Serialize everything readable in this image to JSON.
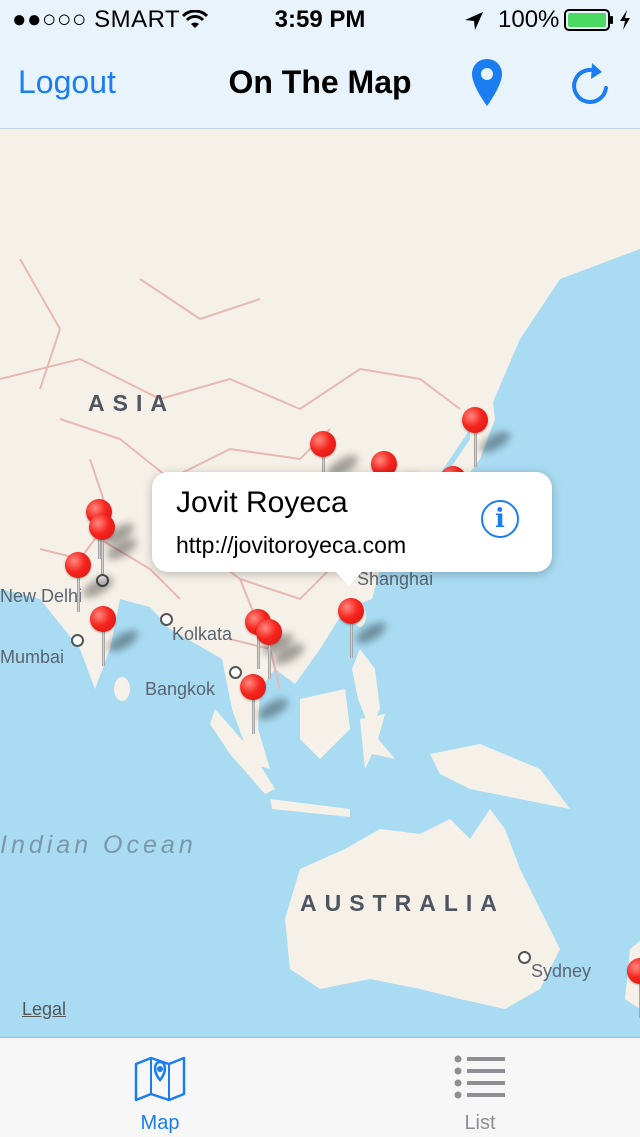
{
  "status_bar": {
    "carrier": "●●○○○ SMART",
    "time": "3:59 PM",
    "battery": "100%"
  },
  "nav": {
    "logout_label": "Logout",
    "title": "On The Map",
    "pin_icon": "location-pin-icon",
    "refresh_icon": "refresh-icon"
  },
  "map": {
    "labels": {
      "asia": "ASIA",
      "new_delhi": "New Delhi",
      "mumbai": "Mumbai",
      "kolkata": "Kolkata",
      "bangkok": "Bangkok",
      "shanghai": "Shanghai",
      "indian_ocean": "Indian Ocean",
      "australia": "AUSTRALIA",
      "sydney": "Sydney"
    },
    "legal": "Legal",
    "colors": {
      "water": "#a9dcf3",
      "land": "#f6f1e8",
      "border": "#e8b9b3",
      "pin": "#f5251e",
      "accent": "#1a7ef2"
    }
  },
  "callout": {
    "name": "Jovit Royeca",
    "url": "http://jovitoroyeca.com",
    "icon": "info-icon"
  },
  "tabs": [
    {
      "label": "Map",
      "icon": "map-icon",
      "selected": true
    },
    {
      "label": "List",
      "icon": "list-icon",
      "selected": false
    }
  ]
}
